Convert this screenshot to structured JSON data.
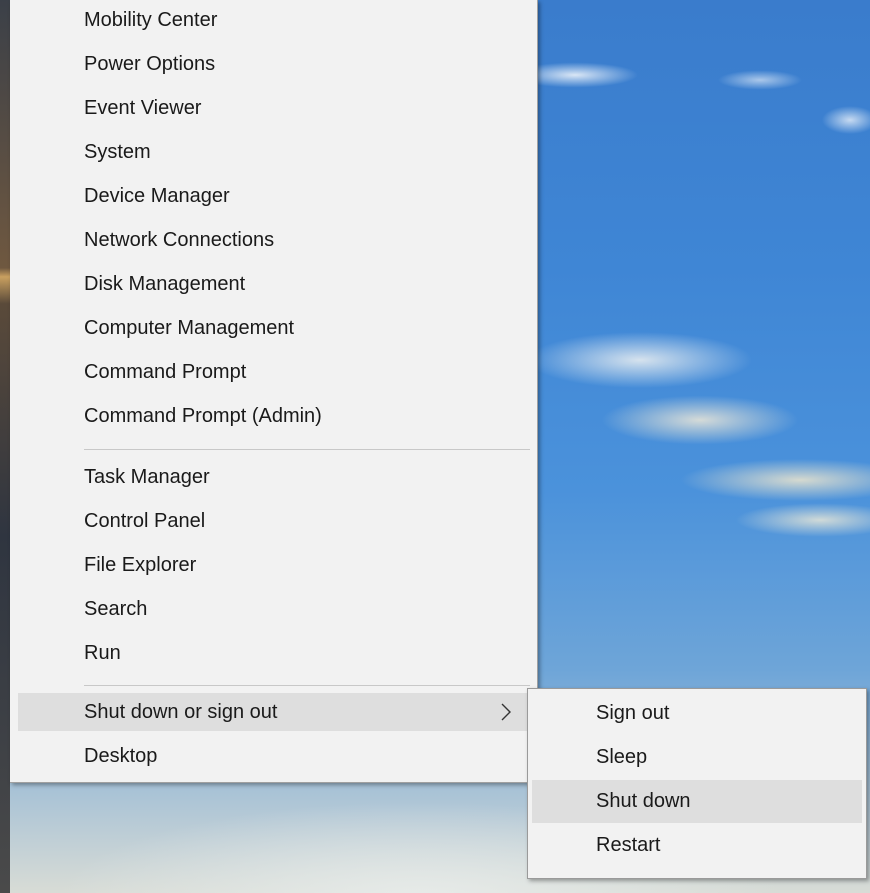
{
  "context_menu": {
    "group1": [
      {
        "label": "Mobility Center"
      },
      {
        "label": "Power Options"
      },
      {
        "label": "Event Viewer"
      },
      {
        "label": "System"
      },
      {
        "label": "Device Manager"
      },
      {
        "label": "Network Connections"
      },
      {
        "label": "Disk Management"
      },
      {
        "label": "Computer Management"
      },
      {
        "label": "Command Prompt"
      },
      {
        "label": "Command Prompt (Admin)"
      }
    ],
    "group2": [
      {
        "label": "Task Manager"
      },
      {
        "label": "Control Panel"
      },
      {
        "label": "File Explorer"
      },
      {
        "label": "Search"
      },
      {
        "label": "Run"
      }
    ],
    "group3": [
      {
        "label": "Shut down or sign out",
        "has_submenu": true,
        "highlighted": true
      },
      {
        "label": "Desktop"
      }
    ]
  },
  "submenu": {
    "items": [
      {
        "label": "Sign out"
      },
      {
        "label": "Sleep"
      },
      {
        "label": "Shut down",
        "highlighted": true
      },
      {
        "label": "Restart"
      }
    ]
  },
  "colors": {
    "menu_background": "#f2f2f2",
    "highlight": "#dedede",
    "separator": "#c8c8c8",
    "text": "#1a1a1a"
  },
  "icons": {
    "submenu_arrow": "chevron-right-icon"
  }
}
